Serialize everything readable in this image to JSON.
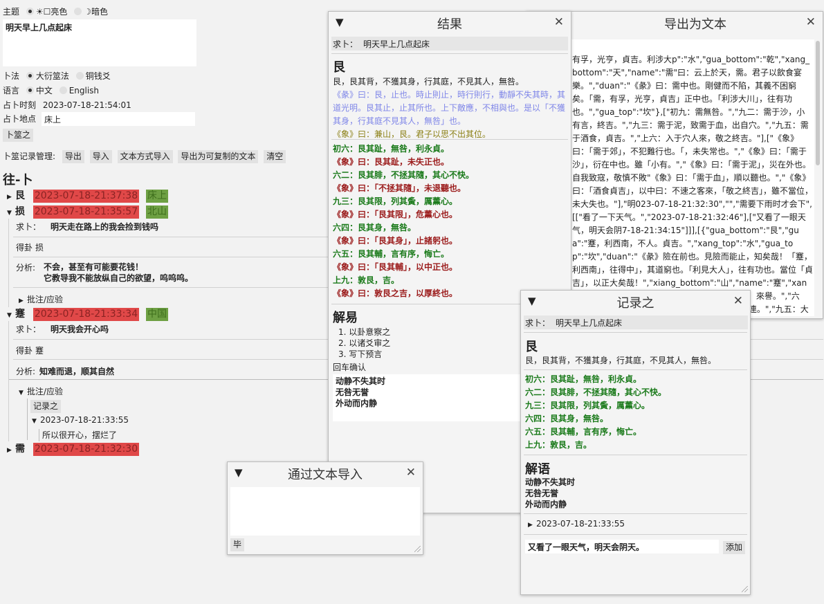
{
  "main": {
    "theme_label": "主题",
    "theme_light": "☀☐亮色",
    "theme_dark": "☽暗色",
    "question_text": "明天早上几点起床",
    "method_label": "卜法",
    "method_1": "大衍筮法",
    "method_2": "铜钱爻",
    "lang_label": "语言",
    "lang_zh": "中文",
    "lang_en": "English",
    "time_label": "占卜时刻",
    "time_value": "2023-07-18-21:54:01",
    "place_label": "占卜地点",
    "place_value": "床上",
    "divine_button": "卜筮之",
    "records_label": "卜筮记录管理:",
    "btn_export": "导出",
    "btn_import": "导入",
    "btn_text_import": "文本方式导入",
    "btn_export_copy": "导出为可复制的文本",
    "btn_clear": "清空",
    "history_title": "往-卜"
  },
  "history": [
    {
      "gua": "艮",
      "time": "2023-07-18-21:37:38",
      "place": "床上"
    },
    {
      "gua": "损",
      "time": "2023-07-18-21:35:57",
      "place": "北山",
      "ask_label": "求卜：",
      "ask": "明天走在路上的我会捡到钱吗",
      "result_label": "得卦",
      "result": "损",
      "analysis_label": "分析:",
      "analysis_1": "不会，甚至有可能要花钱！",
      "analysis_2": "它教导我不能放纵自己的欲望，呜呜呜。",
      "note_label": "批注/应验"
    },
    {
      "gua": "蹇",
      "time": "2023-07-18-21:33:34",
      "place": "中国",
      "ask_label": "求卜：",
      "ask": "明天我会开心吗",
      "result_label": "得卦",
      "result": "蹇",
      "analysis_label": "分析:",
      "analysis": "知难而退，顺其自然",
      "note_label": "批注/应验",
      "record_button": "记录之",
      "note_time": "2023-07-18-21:33:55",
      "note_text": "所以很开心，摆烂了"
    },
    {
      "gua": "需",
      "time": "2023-07-18-21:32:30"
    }
  ],
  "result_dialog": {
    "title": "结果",
    "ask_label": "求卜：",
    "ask": "明天早上几点起床",
    "gua": "艮",
    "judgement": "艮，艮其背，不獲其身，行其庭，不見其人，無咎。",
    "tuan": "《彖》曰：艮，止也。時止則止，時行則行，動靜不失其時，其道光明。艮其止，止其所也。上下敵應，不相與也。是以「不獲其身，行其庭不見其人，無咎」也。",
    "xiang": "《象》曰：兼山，艮。君子以思不出其位。",
    "lines": [
      {
        "text": "初六：艮其趾，無咎，利永貞。",
        "xiang": "《象》曰：艮其趾，未失正也。"
      },
      {
        "text": "六二：艮其腓，不拯其隨，其心不快。",
        "xiang": "《象》曰：「不拯其隨」，未退聽也。"
      },
      {
        "text": "九三：艮其限，列其夤，厲薰心。",
        "xiang": "《象》曰：「艮其限」，危薰心也。"
      },
      {
        "text": "六四：艮其身，無咎。",
        "xiang": "《象》曰：「艮其身」，止諸躬也。"
      },
      {
        "text": "六五：艮其輔，言有序，悔亡。",
        "xiang": "《象》曰：「艮其輔」，以中正也。"
      },
      {
        "text": "上九：敦艮，吉。",
        "xiang": "《象》曰：敦艮之吉，以厚終也。"
      }
    ],
    "jieyi_title": "解易",
    "steps": [
      "以卦意察之",
      "以诸爻审之",
      "写下预言"
    ],
    "enter_label": "回车确认",
    "input_lines": [
      "动静不失其时",
      "无咎无誉",
      "外动而内静"
    ]
  },
  "export_dialog": {
    "title": "导出为文本",
    "content": "有孚，光亨，貞吉。利涉大p\":\"水\",\"gua_bottom\":\"乾\",\"xang_bottom\":\"天\",\"name\":\"需\"曰：云上於天，需。君子以飲食宴樂。\",\"duan\":\"《彖》曰：需中也。剛健而不陷，其義不困窮矣。「需，有孚，光亨，貞吉」正中也。「利涉大川」，往有功也。\",\"gua_top\":\"坎\"},[\"初九：需無咎。\",\"九二：需于沙，小有言，終吉。\",\"九三：需于泥，致需于血，出自穴。\",\"九五：需于酒食，貞吉。\",\"上六：入于穴人來，敬之終吉。\"],[\"《象》曰：「需于郊」，不犯難行也。「，未失常也。\",\"《象》曰：「需于沙」，衍在中也。雖「小有。\",\"《象》曰：「需于泥」，災在外也。自我致寇，敬慎不敗\"《象》曰：「需于血」，順以聽也。\",\"《象》曰：「酒食貞吉」，以中曰：不速之客來，「敬之終吉」，雖不當位，未大失也。\"],\"明023-07-18-21:32:30\",\"\",\"需要下雨时才会下\",[[\"看了一下天气。\",\"2023-07-18-21:32:46\"],[\"又看了一眼天气，明天会阴7-18-21:34:15\"]]],[{\"gua_bottom\":\"艮\",\"gua\":\"蹇，利西南，不人。貞吉。\",\"xang_top\":\"水\",\"gua_top\":\"坎\",\"duan\":\"《彖》險在前也。見險而能止，知矣哉！「蹇，利西南」，往得中」，其道窮也。「利見大人」，往有功也。當位「貞吉」，以正大矣哉！\",\"xiang_bottom\":\"山\",\"name\":\"蹇\",\"xang\":\"《象》曰君子以反身修德。\"},[\"初六：往蹇，來譽。\",\"六二：王臣蹇蹇九三：往蹇來反。\",\"六四：往蹇來連。\",\"九五：大蹇朋"
  },
  "text_import_dialog": {
    "title": "通过文本导入",
    "done_button": "毕"
  },
  "record_dialog": {
    "title": "记录之",
    "ask_label": "求卜：",
    "ask": "明天早上几点起床",
    "gua": "艮",
    "judgement": "艮，艮其背，不獲其身，行其庭，不見其人，無咎。",
    "lines": [
      "初六：艮其趾，無咎，利永貞。",
      "六二：艮其腓，不拯其隨，其心不快。",
      "九三：艮其限，列其夤，厲薰心。",
      "六四：艮其身，無咎。",
      "六五：艮其輔，言有序，悔亡。",
      "上九：敦艮，吉。"
    ],
    "jieyu_title": "解语",
    "jieyu_lines": [
      "动静不失其时",
      "无咎无誉",
      "外动而内静"
    ],
    "note_time": "2023-07-18-21:33:55",
    "input_value": "又看了一眼天气，明天会阴天。",
    "add_button": "添加"
  },
  "colors": {
    "date_bg": "#e04848",
    "place_bg": "#6ea043",
    "line_green": "#1a7a1a",
    "xiang_red": "#9b1b1b",
    "tuan_blue": "#7f86e8"
  }
}
